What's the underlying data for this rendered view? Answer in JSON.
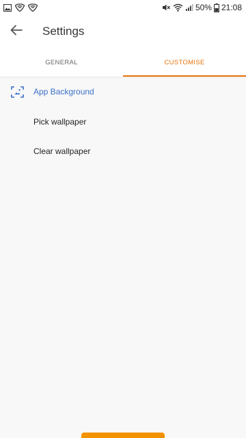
{
  "status_bar": {
    "battery_percent": "50%",
    "time": "21:08",
    "left_icons": [
      "image-icon",
      "shield-wifi-icon",
      "shield-wifi-icon"
    ],
    "right_icons": [
      "mute-icon",
      "wifi-icon",
      "signal-icon",
      "battery-icon"
    ]
  },
  "app_bar": {
    "title": "Settings",
    "back_icon": "arrow-back-icon"
  },
  "tabs": [
    {
      "label": "GENERAL",
      "active": false
    },
    {
      "label": "CUSTOMISE",
      "active": true
    }
  ],
  "colors": {
    "accent": "#e8730c",
    "section_title": "#3a6fc7",
    "handle": "#f39200"
  },
  "section": {
    "title": "App Background",
    "icon": "wallpaper-icon",
    "items": [
      {
        "label": "Pick wallpaper"
      },
      {
        "label": "Clear wallpaper"
      }
    ]
  }
}
